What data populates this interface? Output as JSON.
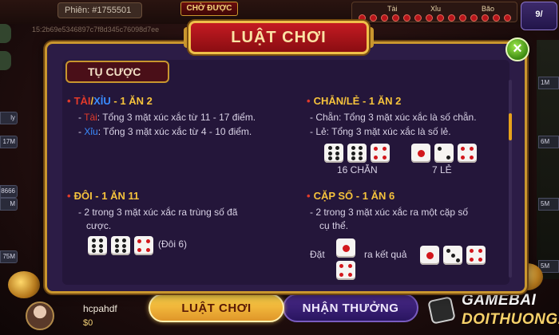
{
  "background": {
    "session_label": "Phiên: #1755501",
    "mode_label": "CHỜ ĐƯỢC",
    "hash_text": "15:2b69e5346897c7f8d345c76098d7ee",
    "history_labels": [
      "Tài",
      "Xỉu",
      "Bão"
    ],
    "right_badge": "9/",
    "side_amounts_left": [
      "ly",
      "8666",
      "M",
      "75M",
      "17M"
    ],
    "side_amounts_right": [
      "1M",
      "6M",
      "5M",
      "5M"
    ]
  },
  "modal": {
    "title": "LUẬT CHƠI",
    "close_label": "×",
    "section_title": "TỤ CƯỢC",
    "rules": {
      "taixiu": {
        "title_tai": "TÀI",
        "title_sep": "/",
        "title_xiu": "XỈU",
        "title_rest": " - 1 ĂN 2",
        "line1_prefix": "- ",
        "line1_key": "Tài",
        "line1_text": ": Tổng 3 mặt xúc xắc từ 11 - 17 điểm.",
        "line2_prefix": "- ",
        "line2_key": "Xỉu",
        "line2_text": ": Tổng 3 mặt xúc xắc từ 4 - 10 điểm."
      },
      "chanle": {
        "title": "CHẴN/LẺ - 1 ĂN 2",
        "line1": "- Chẵn: Tổng 3 mặt xúc xắc là số chẵn.",
        "line2": "- Lẻ: Tổng 3 mặt xúc xắc là số lẻ.",
        "example_even_caption": "16 CHẴN",
        "example_odd_caption": "7 LẺ",
        "example_even_dice": [
          6,
          6,
          4
        ],
        "example_odd_dice": [
          1,
          2,
          4
        ]
      },
      "doi": {
        "title": "ĐÔI - 1 ĂN 11",
        "line1": "- 2 trong 3 mặt xúc xắc ra trùng số đã",
        "line2": "cược.",
        "example_dice": [
          6,
          6,
          4
        ],
        "example_caption": "(Đôi 6)"
      },
      "capso": {
        "title": "CẶP SỐ - 1 ĂN 6",
        "line1": "- 2 trong 3 mặt xúc xắc ra một cặp số",
        "line2": "cụ thể.",
        "bet_label": "Đặt",
        "result_label": "ra kết quả",
        "bet_dice": [
          1,
          4
        ],
        "result_dice": [
          1,
          3,
          4
        ]
      }
    }
  },
  "player": {
    "name": "hcpahdf",
    "money": "$0"
  },
  "tabs": {
    "rules_label": "LUẬT CHƠI",
    "reward_label": "NHẬN THƯỞNG"
  },
  "brand": {
    "line1": "GAMEBAI",
    "line2": "DOITHUONG.IS"
  },
  "colors": {
    "modal_bg": "#2c1c46",
    "gold_border": "#c9962e",
    "title_red": "#c41b22",
    "highlight_red": "#e23a2a",
    "highlight_blue": "#3a8cff",
    "heading_yellow": "#f6c33c",
    "active_tab": "#ffd44a",
    "inactive_tab": "#4a2a8a"
  }
}
